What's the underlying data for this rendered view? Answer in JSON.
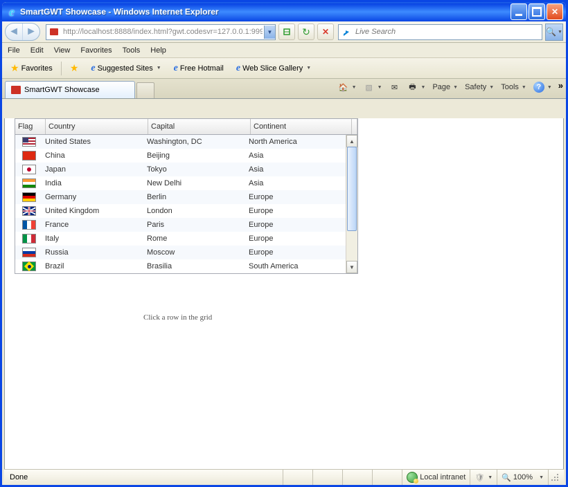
{
  "titlebar": {
    "title": "SmartGWT Showcase - Windows Internet Explorer"
  },
  "addressbar": {
    "url": "http://localhost:8888/index.html?gwt.codesvr=127.0.0.1:999"
  },
  "search": {
    "placeholder": "Live Search"
  },
  "menubar": {
    "file": "File",
    "edit": "Edit",
    "view": "View",
    "favorites": "Favorites",
    "tools": "Tools",
    "help": "Help"
  },
  "favbar": {
    "favorites": "Favorites",
    "suggested": "Suggested Sites",
    "hotmail": "Free Hotmail",
    "webslice": "Web Slice Gallery"
  },
  "tab": {
    "label": "SmartGWT Showcase"
  },
  "cmd": {
    "page": "Page",
    "safety": "Safety",
    "tools": "Tools"
  },
  "grid": {
    "headers": {
      "flag": "Flag",
      "country": "Country",
      "capital": "Capital",
      "continent": "Continent"
    },
    "rows": [
      {
        "flag": "us",
        "country": "United States",
        "capital": "Washington, DC",
        "continent": "North America"
      },
      {
        "flag": "cn",
        "country": "China",
        "capital": "Beijing",
        "continent": "Asia"
      },
      {
        "flag": "jp",
        "country": "Japan",
        "capital": "Tokyo",
        "continent": "Asia"
      },
      {
        "flag": "in",
        "country": "India",
        "capital": "New Delhi",
        "continent": "Asia"
      },
      {
        "flag": "de",
        "country": "Germany",
        "capital": "Berlin",
        "continent": "Europe"
      },
      {
        "flag": "gb",
        "country": "United Kingdom",
        "capital": "London",
        "continent": "Europe"
      },
      {
        "flag": "fr",
        "country": "France",
        "capital": "Paris",
        "continent": "Europe"
      },
      {
        "flag": "it",
        "country": "Italy",
        "capital": "Rome",
        "continent": "Europe"
      },
      {
        "flag": "ru",
        "country": "Russia",
        "capital": "Moscow",
        "continent": "Europe"
      },
      {
        "flag": "br",
        "country": "Brazil",
        "capital": "Brasilia",
        "continent": "South America"
      }
    ]
  },
  "hint": "Click a row in the grid",
  "status": {
    "done": "Done",
    "zone": "Local intranet",
    "zoom": "100%"
  }
}
